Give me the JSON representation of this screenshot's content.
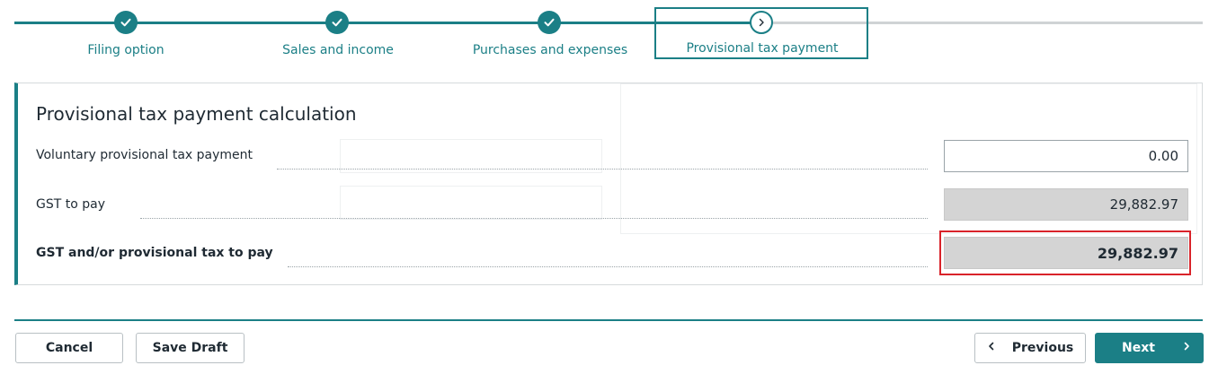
{
  "stepper": {
    "steps": [
      {
        "label": "Filing option",
        "state": "complete"
      },
      {
        "label": "Sales and income",
        "state": "complete"
      },
      {
        "label": "Purchases and expenses",
        "state": "complete"
      },
      {
        "label": "Provisional tax payment",
        "state": "current"
      }
    ]
  },
  "panel": {
    "title": "Provisional tax payment calculation",
    "rows": [
      {
        "label": "Voluntary provisional tax payment",
        "value": "0.00",
        "editable": true
      },
      {
        "label": "GST to pay",
        "value": "29,882.97",
        "editable": false
      },
      {
        "label": "GST and/or provisional tax to pay",
        "value": "29,882.97",
        "editable": false,
        "highlighted": true
      }
    ]
  },
  "footer": {
    "cancel_label": "Cancel",
    "save_draft_label": "Save Draft",
    "previous_label": "Previous",
    "next_label": "Next"
  },
  "colors": {
    "accent": "#1b7f86",
    "pending": "#cfd3d5",
    "highlight": "#d9232a",
    "readonly_bg": "#d4d4d4"
  },
  "icons": [
    "check-icon",
    "chevron-right-icon",
    "chevron-left-icon"
  ]
}
